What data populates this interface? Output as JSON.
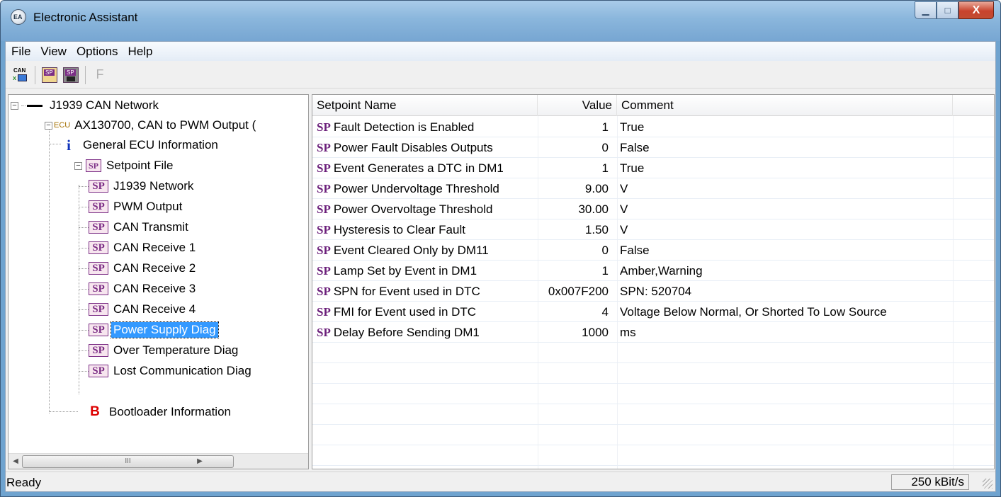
{
  "window": {
    "title": "Electronic Assistant",
    "minimize_glyph": "▁",
    "maximize_glyph": "□",
    "close_glyph": "X"
  },
  "menu": [
    "File",
    "View",
    "Options",
    "Help"
  ],
  "toolbar": {
    "can_label": "CAN",
    "open_sp_label": "SP",
    "save_sp_label": "SP",
    "f_label": "F"
  },
  "tree": {
    "network": {
      "label": "J1939 CAN Network",
      "expander": "−"
    },
    "ecu": {
      "badge": "ECU",
      "label": "AX130700, CAN to PWM Output (",
      "expander": "−"
    },
    "general_info": {
      "icon": "i",
      "label": "General ECU Information"
    },
    "setpoint_file": {
      "badge": "SP",
      "label": "Setpoint File",
      "expander": "−"
    },
    "setpoints": [
      {
        "badge": "SP",
        "label": "J1939 Network",
        "selected": false
      },
      {
        "badge": "SP",
        "label": "PWM Output",
        "selected": false
      },
      {
        "badge": "SP",
        "label": "CAN Transmit",
        "selected": false
      },
      {
        "badge": "SP",
        "label": "CAN Receive 1",
        "selected": false
      },
      {
        "badge": "SP",
        "label": "CAN Receive 2",
        "selected": false
      },
      {
        "badge": "SP",
        "label": "CAN Receive 3",
        "selected": false
      },
      {
        "badge": "SP",
        "label": "CAN Receive 4",
        "selected": false
      },
      {
        "badge": "SP",
        "label": "Power Supply Diag",
        "selected": true
      },
      {
        "badge": "SP",
        "label": "Over Temperature Diag",
        "selected": false
      },
      {
        "badge": "SP",
        "label": "Lost Communication Diag",
        "selected": false
      }
    ],
    "bootloader": {
      "icon": "B",
      "label": "Bootloader Information"
    },
    "scroll": {
      "left": "◀",
      "right": "▶",
      "thumb": "III"
    }
  },
  "grid": {
    "columns": [
      "Setpoint Name",
      "Value",
      "Comment"
    ],
    "rows": [
      {
        "tag": "SP",
        "name": "Fault Detection is Enabled",
        "value": "1",
        "comment": "True"
      },
      {
        "tag": "SP",
        "name": "Power Fault Disables Outputs",
        "value": "0",
        "comment": "False"
      },
      {
        "tag": "SP",
        "name": "Event Generates a DTC in DM1",
        "value": "1",
        "comment": "True"
      },
      {
        "tag": "SP",
        "name": "Power Undervoltage Threshold",
        "value": "9.00",
        "comment": "V"
      },
      {
        "tag": "SP",
        "name": "Power Overvoltage Threshold",
        "value": "30.00",
        "comment": "V"
      },
      {
        "tag": "SP",
        "name": "Hysteresis to Clear Fault",
        "value": "1.50",
        "comment": "V"
      },
      {
        "tag": "SP",
        "name": "Event Cleared Only by DM11",
        "value": "0",
        "comment": "False"
      },
      {
        "tag": "SP",
        "name": "Lamp Set by Event in DM1",
        "value": "1",
        "comment": "Amber,Warning"
      },
      {
        "tag": "SP",
        "name": "SPN for Event used in DTC",
        "value": "0x007F200",
        "comment": "SPN: 520704"
      },
      {
        "tag": "SP",
        "name": "FMI for Event used in DTC",
        "value": "4",
        "comment": "Voltage Below Normal, Or Shorted To Low Source"
      },
      {
        "tag": "SP",
        "name": "Delay Before Sending DM1",
        "value": "1000",
        "comment": "ms"
      }
    ]
  },
  "status": {
    "text": "Ready",
    "baud": "250 kBit/s"
  }
}
